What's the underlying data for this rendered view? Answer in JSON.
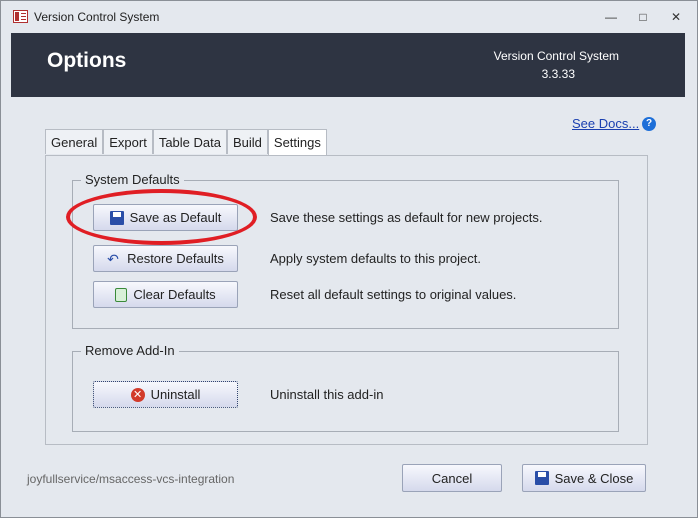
{
  "window": {
    "title": "Version Control System"
  },
  "header": {
    "title": "Options",
    "app_name": "Version Control System",
    "version": "3.3.33"
  },
  "docs_link": {
    "label": "See Docs..."
  },
  "tabs": [
    {
      "label": "General"
    },
    {
      "label": "Export"
    },
    {
      "label": "Table Data"
    },
    {
      "label": "Build"
    },
    {
      "label": "Settings"
    }
  ],
  "active_tab": "Settings",
  "system_defaults": {
    "title": "System Defaults",
    "rows": [
      {
        "button": "Save as Default",
        "icon": "save-icon",
        "description": "Save these settings as default for new projects."
      },
      {
        "button": "Restore Defaults",
        "icon": "undo-icon",
        "description": "Apply system defaults to this project."
      },
      {
        "button": "Clear Defaults",
        "icon": "trash-icon",
        "description": "Reset all default settings to original values."
      }
    ]
  },
  "remove_addin": {
    "title": "Remove Add-In",
    "button": "Uninstall",
    "icon": "remove-icon",
    "description": "Uninstall this add-in"
  },
  "footer": {
    "repo": "joyfullservice/msaccess-vcs-integration",
    "cancel": "Cancel",
    "save_close": "Save & Close"
  },
  "colors": {
    "header_bg": "#2e3442",
    "highlight_ellipse": "#e01e24",
    "link": "#1a3fb0"
  }
}
